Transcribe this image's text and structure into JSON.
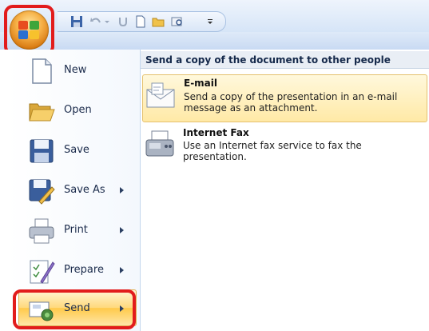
{
  "menu": {
    "items": [
      {
        "label": "New",
        "icon": "new-document-icon"
      },
      {
        "label": "Open",
        "icon": "open-folder-icon"
      },
      {
        "label": "Save",
        "icon": "save-disk-icon"
      },
      {
        "label": "Save As",
        "icon": "save-as-icon",
        "submenu": true
      },
      {
        "label": "Print",
        "icon": "printer-icon",
        "submenu": true
      },
      {
        "label": "Prepare",
        "icon": "prepare-icon",
        "submenu": true
      },
      {
        "label": "Send",
        "icon": "send-icon",
        "submenu": true,
        "selected": true
      }
    ]
  },
  "send_panel": {
    "header": "Send a copy of the document to other people",
    "options": [
      {
        "title": "E-mail",
        "description": "Send a copy of the presentation in an e-mail message as an attachment.",
        "icon": "email-envelope-icon"
      },
      {
        "title": "Internet Fax",
        "description": "Use an Internet fax service to fax the presentation.",
        "icon": "fax-machine-icon"
      }
    ]
  },
  "colors": {
    "highlight_ring": "#e21c1c",
    "hover_fill": "#ffd97c",
    "header_bg": "#e9eef5"
  }
}
